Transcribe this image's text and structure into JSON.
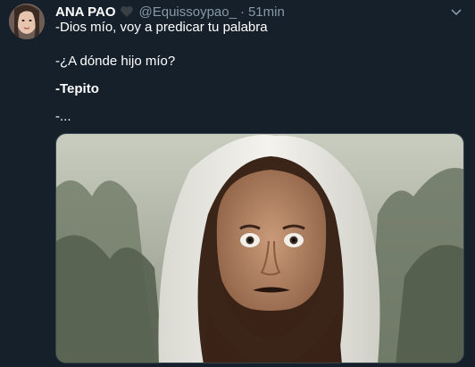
{
  "tweet": {
    "author_name": "ANA PAO",
    "handle": "@Equissoypao_",
    "separator": "·",
    "time": "51min",
    "lines": [
      "-Dios mío, voy a predicar tu palabra",
      "-¿A dónde hijo mío?",
      "-Tepito",
      "-..."
    ]
  },
  "icons": {
    "heart": "black-heart-icon",
    "menu": "chevron-down-icon"
  },
  "colors": {
    "background": "#15202b",
    "secondary_text": "#8899a6",
    "border": "#38444d"
  }
}
